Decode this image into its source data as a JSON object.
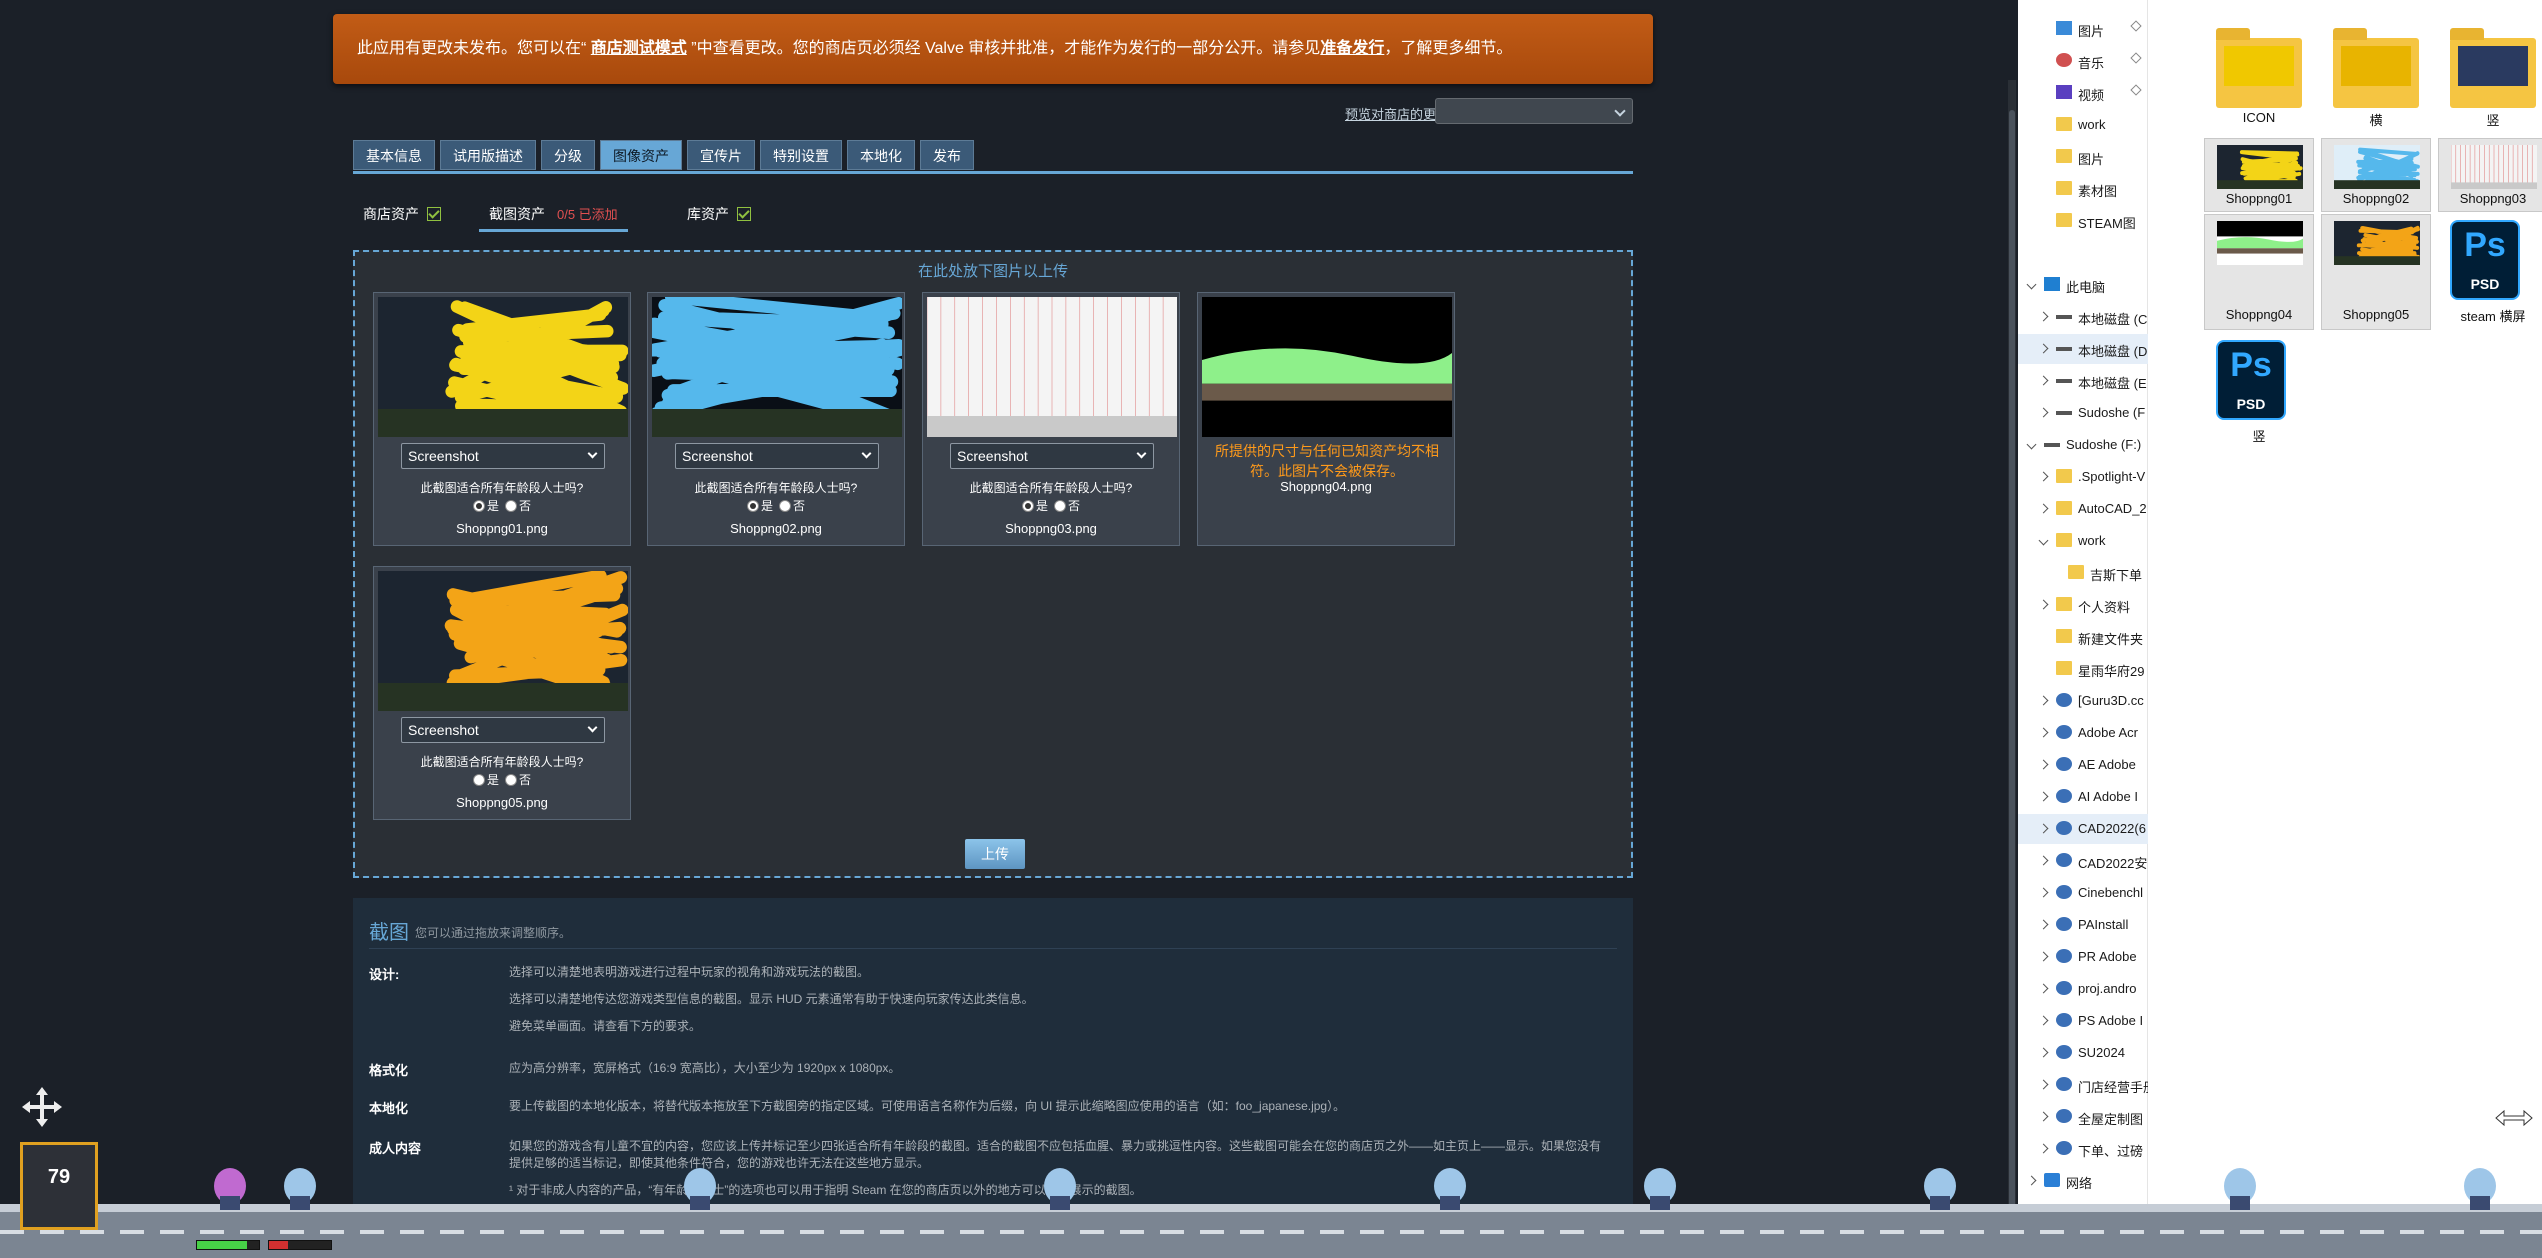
{
  "banner": {
    "pre": "此应用有更改未发布。您可以在“ ",
    "link1": "商店测试模式",
    "mid": " ”中查看更改。您的商店页必须经 Valve 审核并批准，才能作为发行的一部分公开。请参见",
    "link2": "准备发行",
    "post": "，了解更多细节。"
  },
  "preview_link": "预览对商店的更改",
  "tabs": [
    "基本信息",
    "试用版描述",
    "分级",
    "图像资产",
    "宣传片",
    "特别设置",
    "本地化",
    "发布"
  ],
  "active_tab": "图像资产",
  "subtabs": {
    "store": "商店资产",
    "screens": "截图资产",
    "screens_count": "0/5 已添加",
    "library": "库资产"
  },
  "drop_hint": "在此处放下图片以上传",
  "screenshot_select": "Screenshot",
  "age_question": "此截图适合所有年龄段人士吗?",
  "yes": "是",
  "no": "否",
  "cards": [
    {
      "file": "Shoppng01.png",
      "scribble": "#f3d417",
      "bg": "#1c2530"
    },
    {
      "file": "Shoppng02.png",
      "scribble": "#55b8ec",
      "bg": "#0a0f16"
    },
    {
      "file": "Shoppng03.png",
      "scribble": "#ffffff",
      "bg": "#f4f4f4"
    },
    {
      "file": "Shoppng04.png",
      "scribble": "#8ef08a",
      "bg": "#000000",
      "warning": "所提供的尺寸与任何已知资产均不相符。此图片不会被保存。"
    },
    {
      "file": "Shoppng05.png",
      "scribble": "#f3a417",
      "bg": "#1c2530"
    }
  ],
  "upload_label": "上传",
  "info": {
    "title": "截图",
    "hint": "您可以通过拖放来调整顺序。",
    "rows": [
      {
        "label": "设计:",
        "lines": [
          "选择可以清楚地表明游戏进行过程中玩家的视角和游戏玩法的截图。",
          "选择可以清楚地传达您游戏类型信息的截图。显示 HUD 元素通常有助于快速向玩家传达此类信息。",
          "避免菜单画面。请查看下方的要求。"
        ]
      },
      {
        "label": "格式化",
        "lines": [
          "应为高分辨率，宽屏格式（16:9 宽高比），大小至少为 1920px x 1080px。"
        ]
      },
      {
        "label": "本地化",
        "lines": [
          "要上传截图的本地化版本，将替代版本拖放至下方截图旁的指定区域。可使用语言名称作为后缀，向 UI 提示此缩略图应使用的语言（如：foo_japanese.jpg）。"
        ]
      },
      {
        "label": "成人内容",
        "lines": [
          "如果您的游戏含有儿童不宜的内容，您应该上传并标记至少四张适合所有年龄段的截图。适合的截图不应包括血腥、暴力或挑逗性内容。这些截图可能会在您的商店页之外——如主页上——显示。如果您没有提供足够的适当标记，即使其他条件符合，您的游戏也许无法在这些地方显示。",
          "¹ 对于非成人内容的产品，“有年龄段人士”的选项也可以用于指明 Steam 在您的商店页以外的地方可以选取展示的截图。"
        ]
      }
    ]
  },
  "explorer": {
    "nav": [
      {
        "label": "图片",
        "icon": "pic",
        "indent": 1,
        "pin": true
      },
      {
        "label": "音乐",
        "icon": "music",
        "indent": 1,
        "pin": true
      },
      {
        "label": "视频",
        "icon": "video",
        "indent": 1,
        "pin": true
      },
      {
        "label": "work",
        "icon": "folder",
        "indent": 1
      },
      {
        "label": "图片",
        "icon": "folder",
        "indent": 1
      },
      {
        "label": "素材图",
        "icon": "folder",
        "indent": 1
      },
      {
        "label": "STEAM图",
        "icon": "folder",
        "indent": 1
      },
      {
        "label": "",
        "icon": "",
        "indent": 0
      },
      {
        "label": "此电脑",
        "icon": "pc",
        "indent": 0,
        "arrow": "down"
      },
      {
        "label": "本地磁盘 (C",
        "icon": "drive",
        "indent": 1,
        "arrow": "right"
      },
      {
        "label": "本地磁盘 (D",
        "icon": "drive",
        "indent": 1,
        "arrow": "right",
        "selected": true
      },
      {
        "label": "本地磁盘 (E",
        "icon": "drive",
        "indent": 1,
        "arrow": "right"
      },
      {
        "label": "Sudoshe (F",
        "icon": "drive",
        "indent": 1,
        "arrow": "right"
      },
      {
        "label": "Sudoshe (F:)",
        "icon": "drive",
        "indent": 0,
        "arrow": "down"
      },
      {
        "label": ".Spotlight-V",
        "icon": "folder",
        "indent": 1,
        "arrow": "right"
      },
      {
        "label": "AutoCAD_2",
        "icon": "folder",
        "indent": 1,
        "arrow": "right"
      },
      {
        "label": "work",
        "icon": "folder",
        "indent": 1,
        "arrow": "down"
      },
      {
        "label": "吉斯下单",
        "icon": "folder",
        "indent": 2
      },
      {
        "label": "个人资料",
        "icon": "folder",
        "indent": 1,
        "arrow": "right"
      },
      {
        "label": "新建文件夹",
        "icon": "folder",
        "indent": 1
      },
      {
        "label": "星雨华府29",
        "icon": "folder",
        "indent": 1
      },
      {
        "label": "[Guru3D.cc",
        "icon": "app",
        "indent": 1,
        "arrow": "right"
      },
      {
        "label": "Adobe Acr",
        "icon": "app",
        "indent": 1,
        "arrow": "right"
      },
      {
        "label": "AE Adobe",
        "icon": "app",
        "indent": 1,
        "arrow": "right"
      },
      {
        "label": "AI Adobe I",
        "icon": "app",
        "indent": 1,
        "arrow": "right"
      },
      {
        "label": "CAD2022(6",
        "icon": "app",
        "indent": 1,
        "arrow": "right",
        "selected": true
      },
      {
        "label": "CAD2022安",
        "icon": "app",
        "indent": 1,
        "arrow": "right"
      },
      {
        "label": "Cinebenchl",
        "icon": "app",
        "indent": 1,
        "arrow": "right"
      },
      {
        "label": "PAInstall",
        "icon": "app",
        "indent": 1,
        "arrow": "right"
      },
      {
        "label": "PR Adobe",
        "icon": "app",
        "indent": 1,
        "arrow": "right"
      },
      {
        "label": "proj.andro",
        "icon": "app",
        "indent": 1,
        "arrow": "right"
      },
      {
        "label": "PS Adobe I",
        "icon": "app",
        "indent": 1,
        "arrow": "right"
      },
      {
        "label": "SU2024",
        "icon": "app",
        "indent": 1,
        "arrow": "right"
      },
      {
        "label": "门店经营手册",
        "icon": "app",
        "indent": 1,
        "arrow": "right"
      },
      {
        "label": "全屋定制图",
        "icon": "app",
        "indent": 1,
        "arrow": "right"
      },
      {
        "label": "下单、过磅",
        "icon": "app",
        "indent": 1,
        "arrow": "right"
      },
      {
        "label": "网络",
        "icon": "net",
        "indent": 0,
        "arrow": "right"
      }
    ],
    "files": [
      {
        "name": "ICON",
        "type": "folder",
        "paper": "#f0c800"
      },
      {
        "name": "横",
        "type": "folder",
        "paper": "#e8b400"
      },
      {
        "name": "竖",
        "type": "folder",
        "paper": "#2a3a60"
      },
      {
        "name": "Shoppng01",
        "type": "image",
        "color": "#f3d417",
        "bg": "#1c2530",
        "selected": true
      },
      {
        "name": "Shoppng02",
        "type": "image",
        "color": "#55b8ec",
        "bg": "#dfeef8",
        "selected": true
      },
      {
        "name": "Shoppng03",
        "type": "image",
        "color": "#ffffff",
        "bg": "#f4f4f4",
        "selected": true
      },
      {
        "name": "Shoppng04",
        "type": "image",
        "color": "#8ef08a",
        "bg": "#ffffff",
        "selected": true
      },
      {
        "name": "Shoppng05",
        "type": "image",
        "color": "#f3a417",
        "bg": "#1c2530",
        "selected": true
      },
      {
        "name": "steam 横屏",
        "type": "psd"
      },
      {
        "name": "竖",
        "type": "psd"
      }
    ]
  },
  "hud": {
    "score": "79",
    "health": 0.8,
    "energy": 0.3
  }
}
